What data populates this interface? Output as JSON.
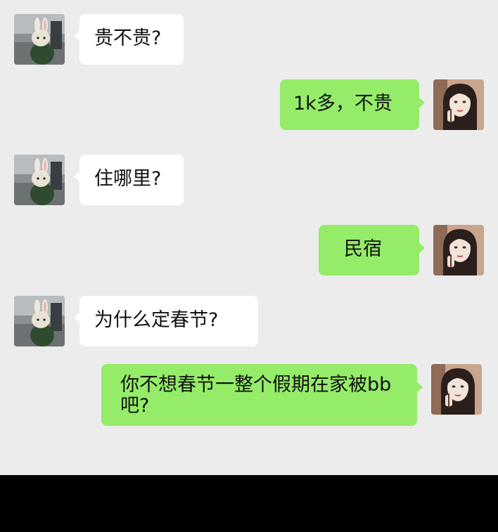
{
  "messages": [
    {
      "side": "left",
      "text": "贵不贵?"
    },
    {
      "side": "right",
      "text": "1k多，不贵"
    },
    {
      "side": "left",
      "text": "住哪里?"
    },
    {
      "side": "right",
      "text": "民宿"
    },
    {
      "side": "left",
      "text": "为什么定春节?"
    },
    {
      "side": "right",
      "text": "你不想春节一整个假期在家被bb吧?"
    }
  ],
  "avatars": {
    "left": "rabbit-costume-avatar-icon",
    "right": "girl-portrait-avatar-icon"
  },
  "colors": {
    "chat_background": "#ececec",
    "incoming_bubble": "#ffffff",
    "outgoing_bubble": "#95ec69",
    "bottom_bar": "#000000"
  }
}
